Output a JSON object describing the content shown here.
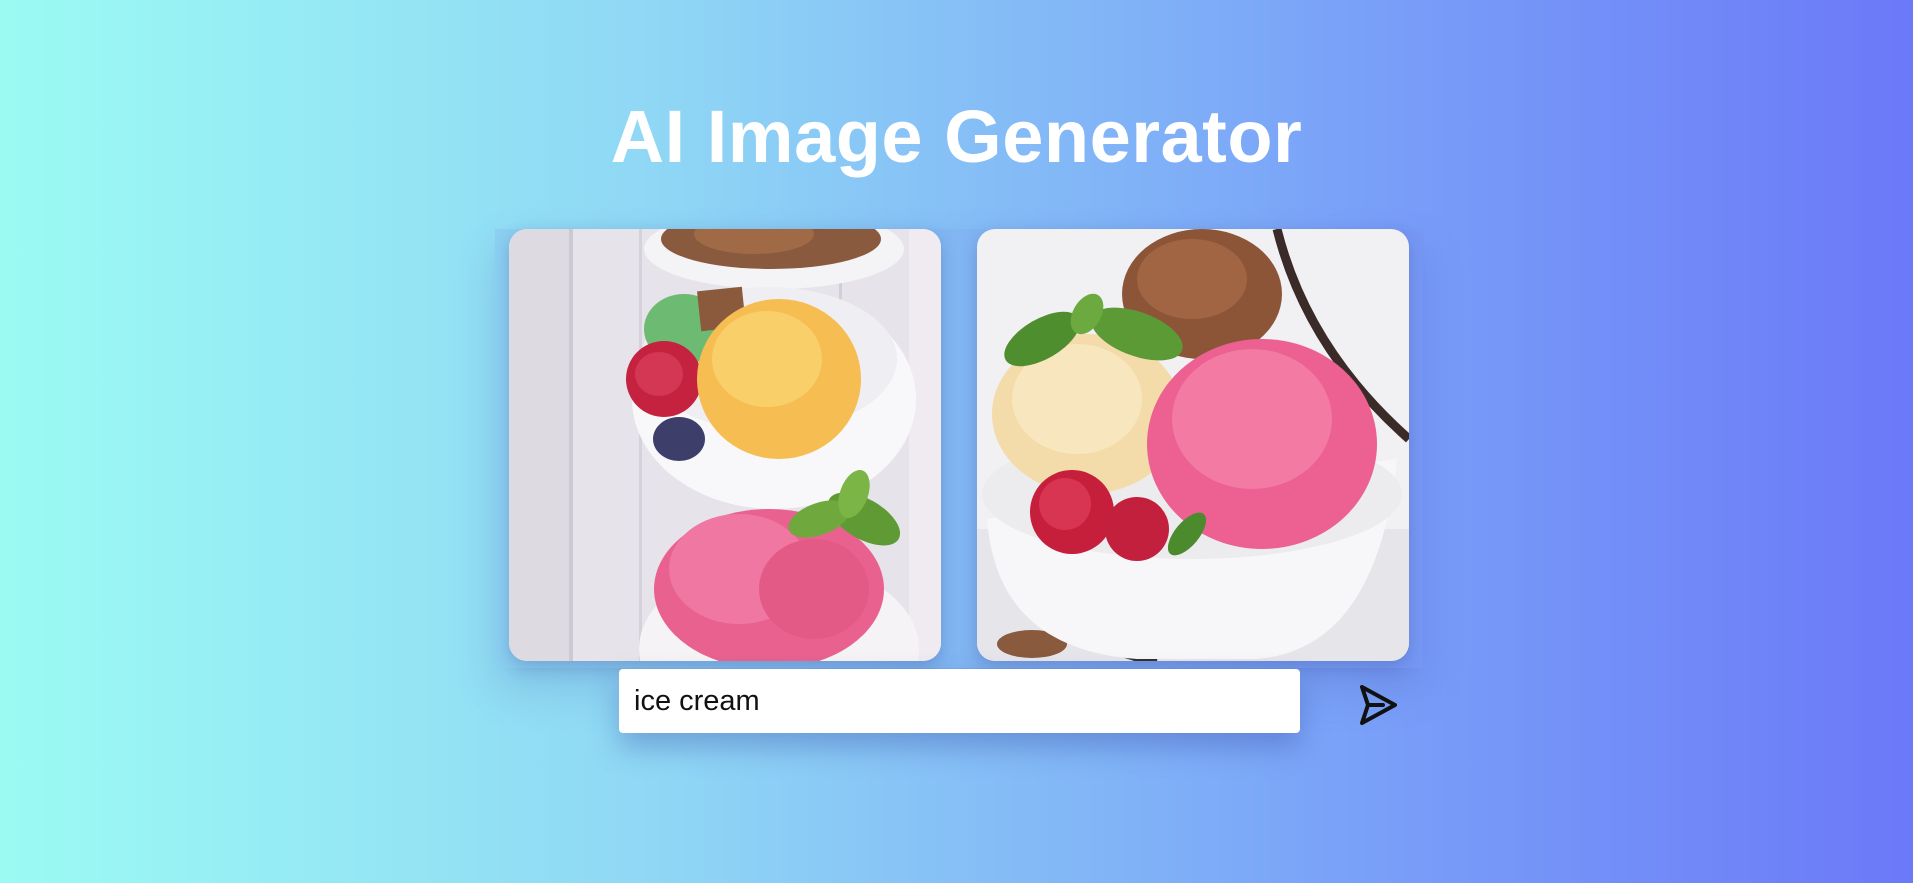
{
  "app": {
    "title": "AI Image Generator"
  },
  "gallery": {
    "images": [
      {
        "alt": "ice cream bowls on wooden table"
      },
      {
        "alt": "ice cream bowl with mint and raspberries"
      }
    ]
  },
  "prompt": {
    "value": "ice cream",
    "placeholder": ""
  },
  "send": {
    "icon": "send-icon"
  },
  "colors": {
    "gradient_start": "#9bfbf3",
    "gradient_end": "#6b79f8",
    "title": "#ffffff"
  }
}
